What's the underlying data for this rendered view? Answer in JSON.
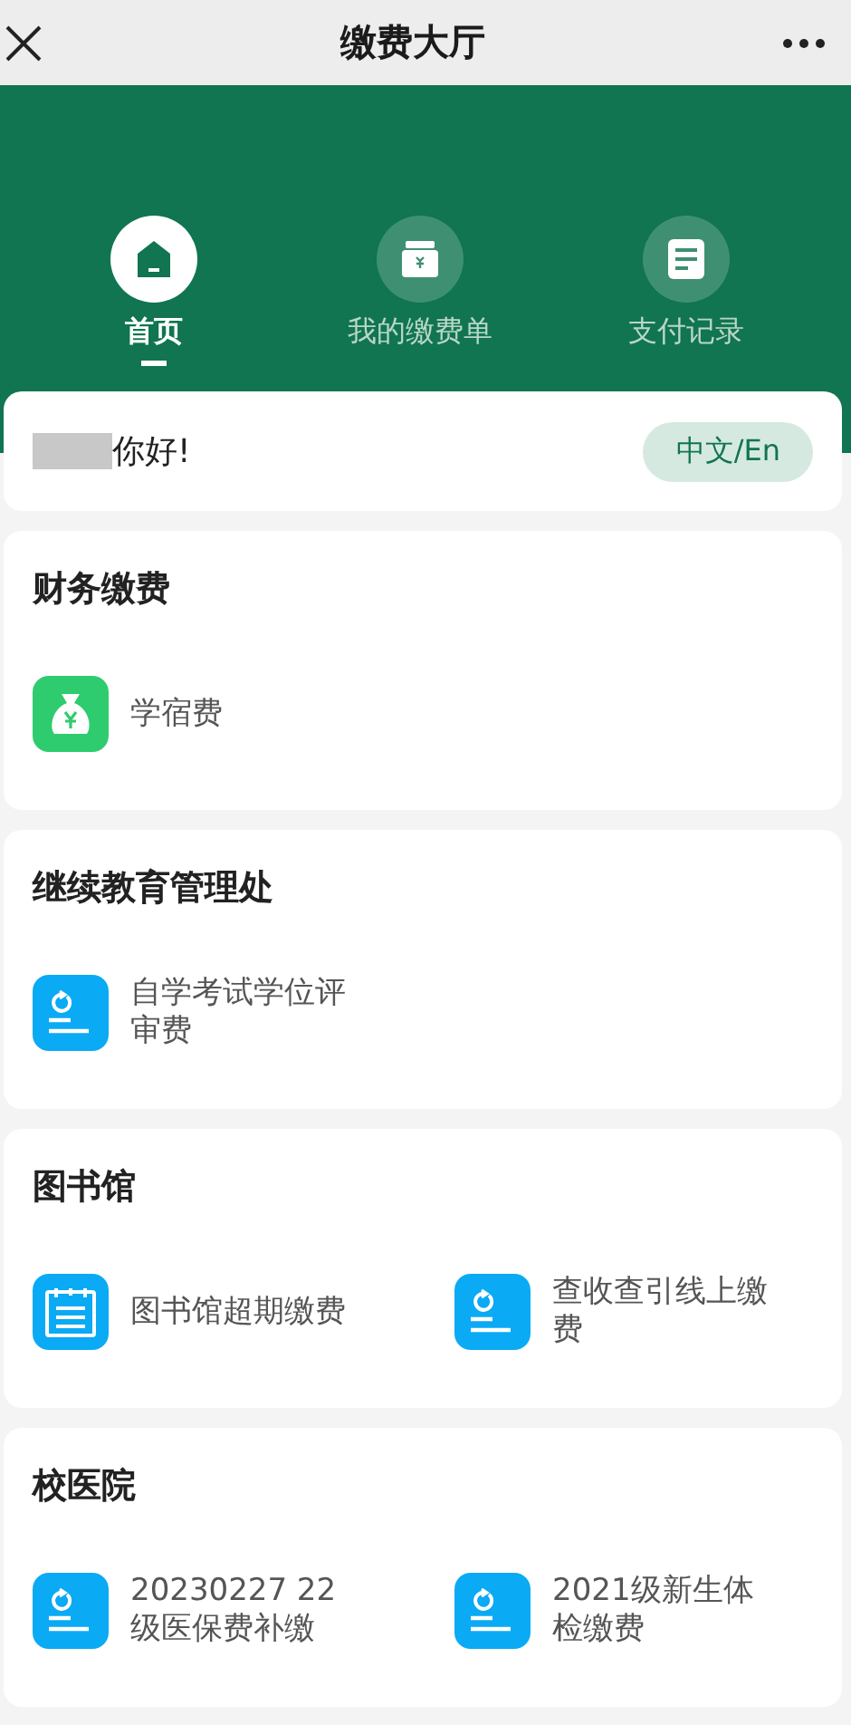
{
  "header": {
    "title": "缴费大厅"
  },
  "tabs": [
    {
      "label": "首页",
      "kind": "home",
      "selected": true
    },
    {
      "label": "我的缴费单",
      "kind": "wallet",
      "selected": false
    },
    {
      "label": "支付记录",
      "kind": "record",
      "selected": false
    }
  ],
  "greeting": {
    "text": "你好!",
    "language_button": "中文/En"
  },
  "sections": [
    {
      "title": "财务缴费",
      "items": [
        {
          "label": "学宿费",
          "kind": "moneybag"
        }
      ]
    },
    {
      "title": "继续教育管理处",
      "items": [
        {
          "label": "自学考试学位评审费",
          "kind": "bill"
        }
      ]
    },
    {
      "title": "图书馆",
      "items": [
        {
          "label": "图书馆超期缴费",
          "kind": "calendar"
        },
        {
          "label": "查收查引线上缴费",
          "kind": "bill"
        }
      ]
    },
    {
      "title": "校医院",
      "items": [
        {
          "label": "20230227 22级医保费补缴",
          "kind": "bill"
        },
        {
          "label": "2021级新生体检缴费",
          "kind": "bill"
        }
      ]
    }
  ]
}
